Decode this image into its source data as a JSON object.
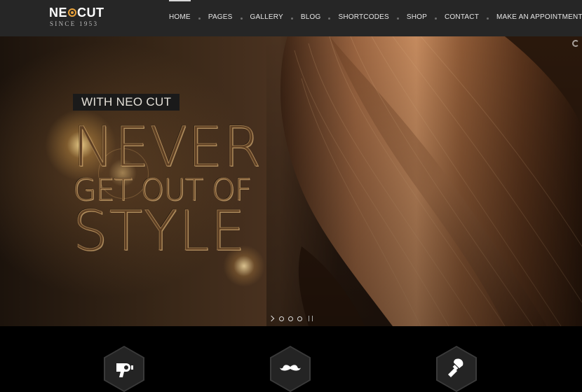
{
  "header": {
    "logo": {
      "word_left": "NE",
      "word_right": "CUT",
      "since": "SINCE 1953"
    },
    "nav": [
      {
        "label": "HOME",
        "active": true
      },
      {
        "label": "PAGES"
      },
      {
        "label": "GALLERY"
      },
      {
        "label": "BLOG"
      },
      {
        "label": "SHORTCODES"
      },
      {
        "label": "SHOP"
      },
      {
        "label": "CONTACT"
      },
      {
        "label": "MAKE AN APPOINTMENT"
      }
    ]
  },
  "hero": {
    "tag": "WITH NEO CUT",
    "headline": [
      "NEVER",
      "GET OUT OF",
      "STYLE"
    ],
    "slides": 3,
    "active_slide": 1
  },
  "services": [
    {
      "icon": "hair-dryer-icon"
    },
    {
      "icon": "mustache-icon"
    },
    {
      "icon": "shaving-brush-icon"
    }
  ],
  "colors": {
    "header_bg": "#262626",
    "accent": "#e8a13a",
    "headline": "#5e4024"
  }
}
